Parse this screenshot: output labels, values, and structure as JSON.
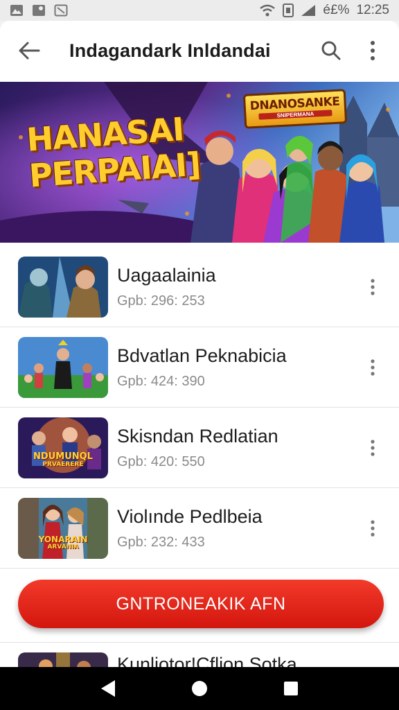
{
  "status_bar": {
    "time": "12:25",
    "battery_text": "é£%"
  },
  "toolbar": {
    "title": "Indagandark Inldandai",
    "back_icon": "arrow-back-icon",
    "search_icon": "search-icon",
    "more_icon": "more-vert-icon"
  },
  "banner": {
    "headline_line1": "HANASAI",
    "headline_line2": "PERPAIAI]",
    "logo_title": "DNANOSANKE",
    "logo_sub": "SNIPERMANA"
  },
  "list": {
    "items": [
      {
        "title": "Uagaalainia",
        "meta": "Gpb: 296: 253"
      },
      {
        "title": "Bdvatlan Peknabicia",
        "meta": "Gpb: 424: 390"
      },
      {
        "title": "Skisndan Redlatian",
        "meta": "Gpb: 420: 550"
      },
      {
        "title": "Violınde Pedlbeia",
        "meta": "Gpb: 232: 433"
      }
    ],
    "partial_title": "Kunliotor!Cflion Sotka"
  },
  "thumb_text": {
    "item3_line1": "NDUMUNQL",
    "item3_line2": "PRVAERERE",
    "item4_line1": "YONARAIN",
    "item4_line2": "ARVANIA"
  },
  "cta": {
    "label": "GNTRONEAKIK AFN"
  },
  "colors": {
    "accent": "#e3261a",
    "title_text": "#1d1d1d",
    "meta_text": "#8a8a8a"
  }
}
